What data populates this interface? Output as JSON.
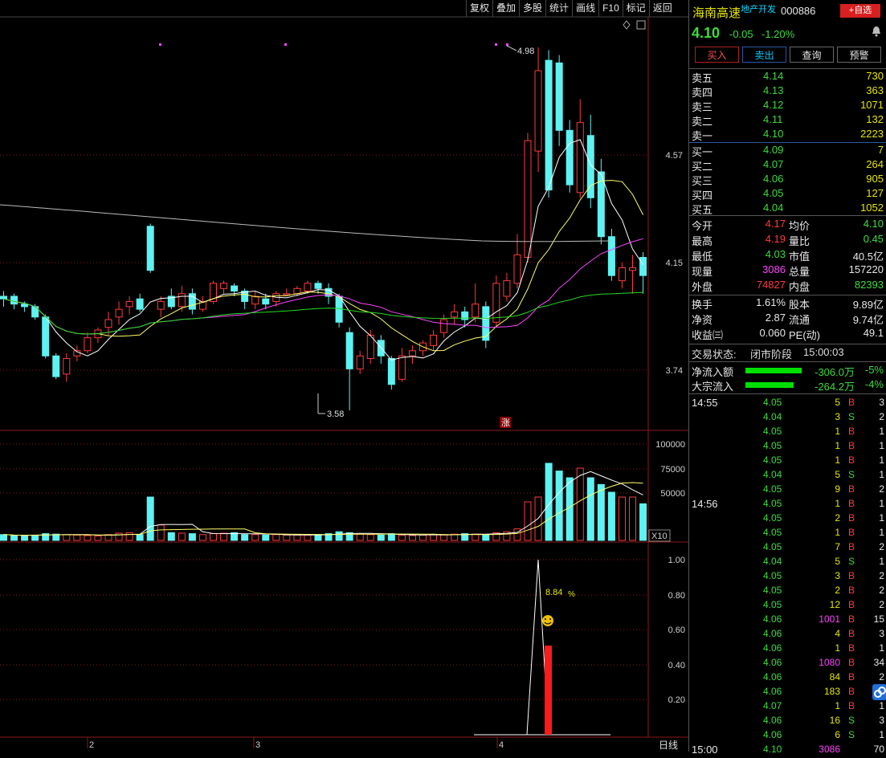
{
  "toolbar": {
    "items": [
      "复权",
      "叠加",
      "多股",
      "统计",
      "画线",
      "F10",
      "标记",
      "返回"
    ]
  },
  "chart": {
    "price_labels": [
      "4.57",
      "4.15",
      "3.74"
    ],
    "high_annot": "4.98",
    "low_annot": "3.58",
    "zhang_label": "涨",
    "vol_labels": [
      "100000",
      "75000",
      "50000"
    ],
    "vol_multiplier": "X10",
    "ind_labels": [
      "1.00",
      "0.80",
      "0.60",
      "0.40",
      "0.20"
    ],
    "ind_annot": "8.84",
    "ind_annot_unit": "%",
    "month_labels": [
      "2",
      "3",
      "4"
    ],
    "period_label": "日线"
  },
  "chart_data": {
    "type": "candlestick",
    "price_axis": [
      3.74,
      4.15,
      4.57
    ],
    "high": 4.98,
    "low": 3.58,
    "volume_axis": [
      50000,
      75000,
      100000
    ],
    "indicator_axis": [
      0.2,
      0.4,
      0.6,
      0.8,
      1.0
    ],
    "indicator_peak_label": "8.84 %"
  },
  "stock": {
    "name": "海南高速",
    "sector": "地产开发",
    "code": "000886",
    "fav_button": "+自选",
    "price": "4.10",
    "change": "-0.05",
    "change_pct": "-1.20%"
  },
  "actions": {
    "buy": "买入",
    "sell": "卖出",
    "query": "查询",
    "alert": "预警"
  },
  "orderbook": {
    "asks": [
      {
        "label": "卖五",
        "price": "4.14",
        "vol": "730"
      },
      {
        "label": "卖四",
        "price": "4.13",
        "vol": "363"
      },
      {
        "label": "卖三",
        "price": "4.12",
        "vol": "1071"
      },
      {
        "label": "卖二",
        "price": "4.11",
        "vol": "132"
      },
      {
        "label": "卖一",
        "price": "4.10",
        "vol": "2223"
      }
    ],
    "bids": [
      {
        "label": "买一",
        "price": "4.09",
        "vol": "7"
      },
      {
        "label": "买二",
        "price": "4.07",
        "vol": "264"
      },
      {
        "label": "买三",
        "price": "4.06",
        "vol": "905"
      },
      {
        "label": "买四",
        "price": "4.05",
        "vol": "127"
      },
      {
        "label": "买五",
        "price": "4.04",
        "vol": "1052"
      }
    ]
  },
  "stats": [
    {
      "l1": "今开",
      "v1": "4.17",
      "c1": "red",
      "l2": "均价",
      "v2": "4.10",
      "c2": "green"
    },
    {
      "l1": "最高",
      "v1": "4.19",
      "c1": "red",
      "l2": "量比",
      "v2": "0.45",
      "c2": "green"
    },
    {
      "l1": "最低",
      "v1": "4.03",
      "c1": "green",
      "l2": "市值",
      "v2": "40.5亿",
      "c2": "white"
    },
    {
      "l1": "现量",
      "v1": "3086",
      "c1": "magenta",
      "l2": "总量",
      "v2": "157220",
      "c2": "white"
    },
    {
      "l1": "外盘",
      "v1": "74827",
      "c1": "red",
      "l2": "内盘",
      "v2": "82393",
      "c2": "green"
    }
  ],
  "stats2": [
    {
      "l1": "换手",
      "v1": "1.61%",
      "l2": "股本",
      "v2": "9.89亿"
    },
    {
      "l1": "净资",
      "v1": "2.87",
      "l2": "流通",
      "v2": "9.74亿"
    },
    {
      "l1": "收益㈢",
      "v1": "0.060",
      "l2": "PE(动)",
      "v2": "49.1"
    }
  ],
  "trade_status": {
    "label": "交易状态:",
    "value": "闭市阶段",
    "time": "15:00:03"
  },
  "flows": [
    {
      "label": "净流入额",
      "value": "-306.0万",
      "pct": "-5%",
      "bar": 0.58
    },
    {
      "label": "大宗流入",
      "value": "-264.2万",
      "pct": "-4%",
      "bar": 0.5
    }
  ],
  "ticks": {
    "time1": "14:55",
    "time2": "14:56",
    "time3": "15:00",
    "rows1": [
      {
        "p": "4.05",
        "v": "5",
        "s": "B",
        "n": "3"
      },
      {
        "p": "4.04",
        "v": "3",
        "s": "S",
        "n": "2"
      },
      {
        "p": "4.05",
        "v": "1",
        "s": "B",
        "n": "1"
      },
      {
        "p": "4.05",
        "v": "1",
        "s": "B",
        "n": "1"
      },
      {
        "p": "4.05",
        "v": "1",
        "s": "B",
        "n": "1"
      },
      {
        "p": "4.04",
        "v": "5",
        "s": "S",
        "n": "1"
      },
      {
        "p": "4.05",
        "v": "9",
        "s": "B",
        "n": "2"
      }
    ],
    "rows2": [
      {
        "p": "4.05",
        "v": "1",
        "s": "B",
        "n": "1"
      },
      {
        "p": "4.05",
        "v": "2",
        "s": "B",
        "n": "1"
      },
      {
        "p": "4.05",
        "v": "1",
        "s": "B",
        "n": "1"
      },
      {
        "p": "4.05",
        "v": "7",
        "s": "B",
        "n": "2"
      },
      {
        "p": "4.04",
        "v": "5",
        "s": "S",
        "n": "1"
      },
      {
        "p": "4.05",
        "v": "3",
        "s": "B",
        "n": "2"
      },
      {
        "p": "4.05",
        "v": "2",
        "s": "B",
        "n": "2"
      },
      {
        "p": "4.05",
        "v": "12",
        "s": "B",
        "n": "2"
      },
      {
        "p": "4.06",
        "v": "1001",
        "s": "B",
        "n": "15"
      },
      {
        "p": "4.06",
        "v": "4",
        "s": "B",
        "n": "3"
      },
      {
        "p": "4.06",
        "v": "1",
        "s": "B",
        "n": "1"
      },
      {
        "p": "4.06",
        "v": "1080",
        "s": "B",
        "n": "34"
      },
      {
        "p": "4.06",
        "v": "84",
        "s": "B",
        "n": "2"
      },
      {
        "p": "4.06",
        "v": "183",
        "s": "B",
        "n": "6"
      },
      {
        "p": "4.07",
        "v": "1",
        "s": "B",
        "n": "1"
      },
      {
        "p": "4.06",
        "v": "16",
        "s": "S",
        "n": "3"
      },
      {
        "p": "4.06",
        "v": "6",
        "s": "S",
        "n": "1"
      }
    ],
    "last": {
      "p": "4.10",
      "v": "3086",
      "n": "70"
    }
  },
  "colors": {
    "up": "#ff3b3b",
    "down": "#5ef2f2",
    "grid": "#8b1a1a"
  }
}
